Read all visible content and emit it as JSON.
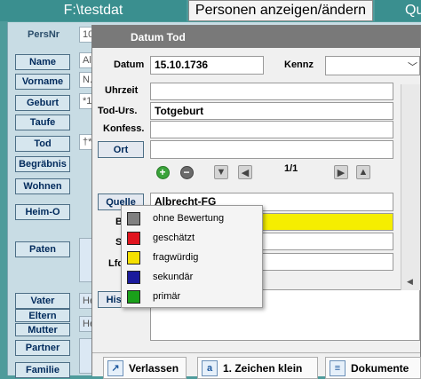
{
  "tabs": {
    "left": "F:\\testdat",
    "active": "Personen anzeigen/ändern",
    "right": "Qu"
  },
  "main": {
    "persnr_label": "PersNr",
    "persnr_value": "10",
    "buttons": {
      "name": "Name",
      "vorname": "Vorname",
      "geburt": "Geburt",
      "taufe": "Taufe",
      "tod": "Tod",
      "begraebnis": "Begräbnis",
      "wohnen": "Wohnen",
      "heim_o": "Heim-O",
      "paten": "Paten",
      "vater": "Vater",
      "eltern": "Eltern",
      "mutter": "Mutter",
      "partner": "Partner",
      "familie": "Familie"
    },
    "field_values": {
      "name": "Al",
      "vorname": "N.",
      "geburt": "*1",
      "tod": "†*",
      "vater": "He",
      "mutter": "He"
    }
  },
  "dialog": {
    "title": "Datum Tod",
    "datum_label": "Datum",
    "datum_value": "15.10.1736",
    "kennz_label": "Kennz",
    "uhrzeit_label": "Uhrzeit",
    "todurs_label": "Tod-Urs.",
    "todurs_value": "Totgeburt",
    "konfess_label": "Konfess.",
    "ort_button": "Ort",
    "record_counter": "1/1",
    "quelle_button": "Quelle",
    "quelle_value": "Albrecht-FG",
    "b_label": "B",
    "s_label": "S",
    "lfd_label": "Lfd",
    "hist_button": "Hist",
    "bottom_buttons": {
      "verlassen": "Verlassen",
      "zeichen": "1. Zeichen klein",
      "dokumente": "Dokumente"
    }
  },
  "popup": {
    "items": [
      {
        "label": "ohne Bewertung",
        "color": "#808080"
      },
      {
        "label": "geschätzt",
        "color": "#e0141e"
      },
      {
        "label": "fragwürdig",
        "color": "#f5e000"
      },
      {
        "label": "sekundär",
        "color": "#1a1a9c"
      },
      {
        "label": "primär",
        "color": "#1aa01a"
      }
    ]
  }
}
